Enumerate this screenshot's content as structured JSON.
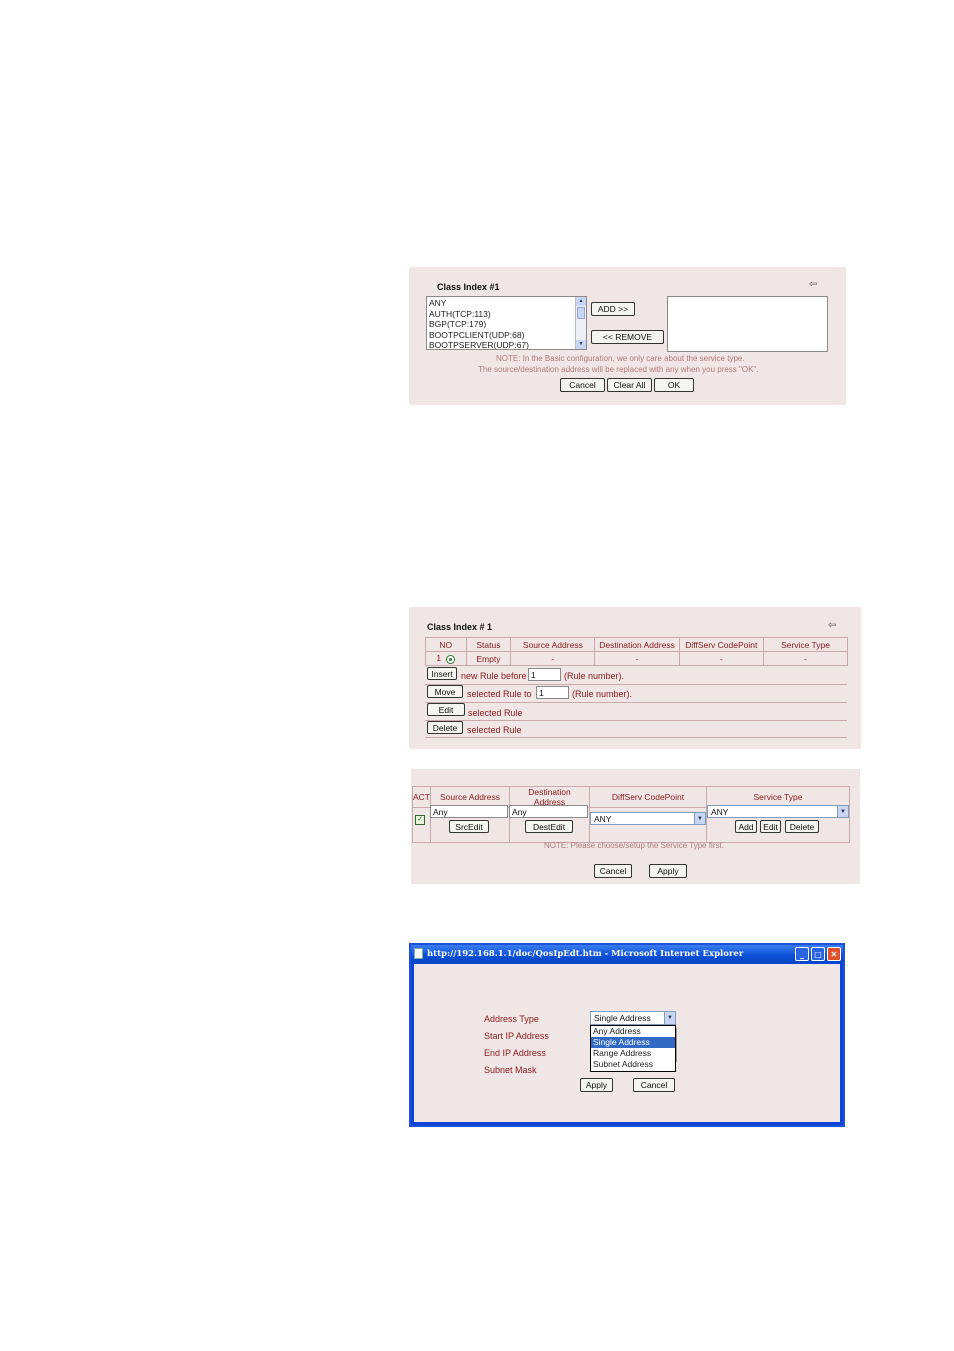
{
  "panel1": {
    "title": "Class Index #1",
    "service_list": [
      "ANY",
      "AUTH(TCP:113)",
      "BGP(TCP:179)",
      "BOOTPCLIENT(UDP:68)",
      "BOOTPSERVER(UDP:67)"
    ],
    "add_label": "ADD >>",
    "remove_label": "<< REMOVE",
    "note_line1": "NOTE: In the Basic configuration, we only care about the service type.",
    "note_line2": "The source/destination address will be replaced with any when you press \"OK\".",
    "cancel_label": "Cancel",
    "clear_all_label": "Clear All",
    "ok_label": "OK"
  },
  "panel2": {
    "title": "Class Index # 1",
    "headers": [
      "NO",
      "Status",
      "Source Address",
      "Destination Address",
      "DiffServ CodePoint",
      "Service Type"
    ],
    "row": {
      "no": "1",
      "status": "Empty",
      "source": "-",
      "destination": "-",
      "dscp": "-",
      "service": "-"
    },
    "insert_label": "Insert",
    "insert_text": "new Rule before",
    "insert_value": "1",
    "rule_number_text": "(Rule number).",
    "move_label": "Move",
    "move_text": "selected Rule to",
    "move_value": "1",
    "move_rule_number_text": "(Rule number).",
    "edit_label": "Edit",
    "edit_text": "selected Rule",
    "delete_label": "Delete",
    "delete_text": "selected Rule"
  },
  "panel3": {
    "headers": [
      "ACT",
      "Source Address",
      "Destination Address",
      "DiffServ CodePoint",
      "Service Type"
    ],
    "source_value": "Any",
    "destination_value": "Any",
    "src_edit_label": "SrcEdit",
    "dest_edit_label": "DestEdit",
    "dscp_value": "ANY",
    "service_value": "ANY",
    "add_label": "Add",
    "edit_label": "Edit",
    "delete_label": "Delete",
    "note": "NOTE: Please choose/setup the Service Type first.",
    "cancel_label": "Cancel",
    "apply_label": "Apply"
  },
  "ie_window": {
    "title": "http://192.168.1.1/doc/QosIpEdt.htm - Microsoft Internet Explorer",
    "labels": {
      "address_type": "Address Type",
      "start_ip": "Start IP Address",
      "end_ip": "End IP Address",
      "subnet_mask": "Subnet Mask"
    },
    "address_type_value": "Single Address",
    "dropdown_options": [
      "Any Address",
      "Single Address",
      "Range Address",
      "Subnet Address"
    ],
    "selected_option": "Single Address",
    "apply_label": "Apply",
    "cancel_label": "Cancel"
  }
}
